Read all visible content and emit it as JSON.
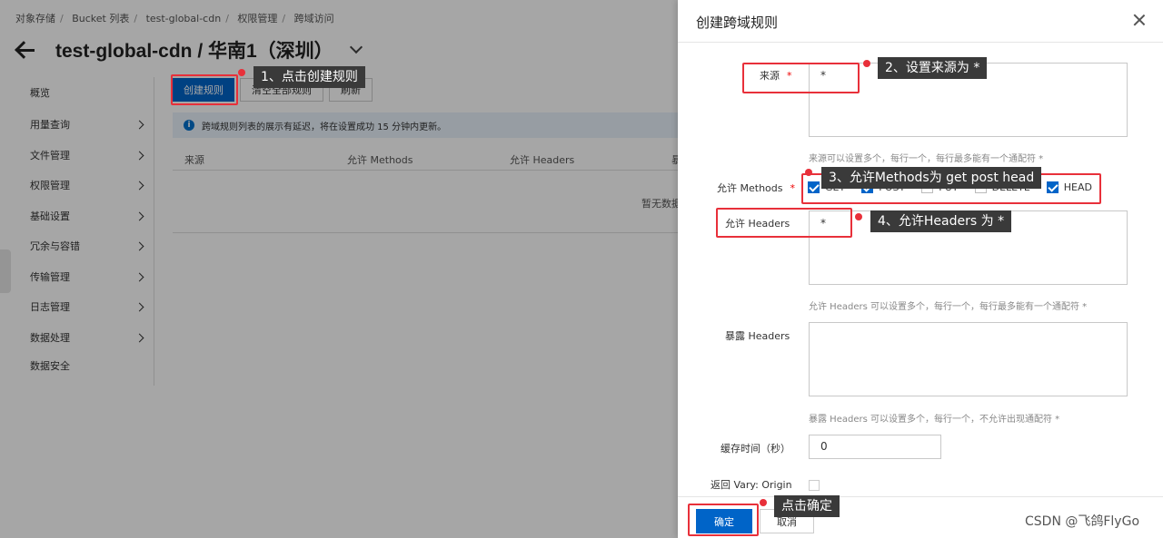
{
  "breadcrumb": [
    "对象存储",
    "Bucket 列表",
    "test-global-cdn",
    "权限管理",
    "跨域访问"
  ],
  "page_title": "test-global-cdn / 华南1（深圳）",
  "sidebar": {
    "items": [
      {
        "label": "概览",
        "chevron": false
      },
      {
        "label": "用量查询",
        "chevron": true
      },
      {
        "label": "文件管理",
        "chevron": true
      },
      {
        "label": "权限管理",
        "chevron": true
      },
      {
        "label": "基础设置",
        "chevron": true
      },
      {
        "label": "冗余与容错",
        "chevron": true
      },
      {
        "label": "传输管理",
        "chevron": true
      },
      {
        "label": "日志管理",
        "chevron": true
      },
      {
        "label": "数据处理",
        "chevron": true
      },
      {
        "label": "数据安全",
        "chevron": false
      }
    ]
  },
  "toolbar": {
    "create_label": "创建规则",
    "clear_label": "清空全部规则",
    "refresh_label": "刷新"
  },
  "info_text": "跨域规则列表的展示有延迟，将在设置成功 15 分钟内更新。",
  "table": {
    "columns": [
      "来源",
      "允许 Methods",
      "允许 Headers",
      "暴"
    ],
    "empty_text": "暂无数据"
  },
  "drawer": {
    "title": "创建跨域规则",
    "origin": {
      "label": "来源",
      "value": "*",
      "hint": "来源可以设置多个，每行一个，每行最多能有一个通配符 *"
    },
    "methods": {
      "label": "允许 Methods",
      "options": [
        {
          "label": "GET",
          "checked": true
        },
        {
          "label": "POST",
          "checked": true
        },
        {
          "label": "PUT",
          "checked": false
        },
        {
          "label": "DELETE",
          "checked": false
        },
        {
          "label": "HEAD",
          "checked": true
        }
      ]
    },
    "allow_headers": {
      "label": "允许 Headers",
      "value": "*",
      "hint": "允许 Headers 可以设置多个，每行一个，每行最多能有一个通配符 *"
    },
    "expose_headers": {
      "label": "暴露 Headers",
      "value": "",
      "hint": "暴露 Headers 可以设置多个，每行一个，不允许出现通配符 *"
    },
    "cache_time": {
      "label": "缓存时间（秒）",
      "value": "0"
    },
    "vary": {
      "label": "返回 Vary: Origin",
      "checked": false
    },
    "ok_label": "确定",
    "cancel_label": "取消"
  },
  "annotations": {
    "step1": "1、点击创建规则",
    "step2": "2、设置来源为 *",
    "step3": "3、允许Methods为 get post head",
    "step4": "4、允许Headers 为 *",
    "step5": "点击确定"
  },
  "watermark": "CSDN @飞鸽FlyGo",
  "colors": {
    "primary": "#0064c8",
    "annotation_red": "#e8303a",
    "tooltip_bg": "#3a3a3a"
  }
}
